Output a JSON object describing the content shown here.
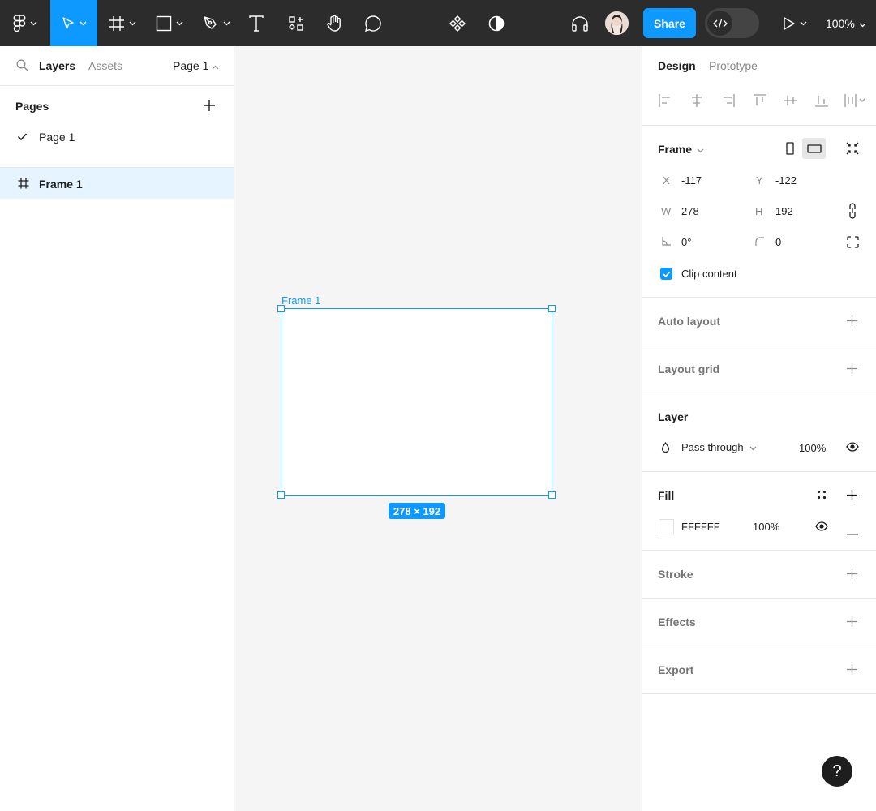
{
  "toolbar": {
    "share_label": "Share",
    "zoom_label": "100%",
    "tools": [
      "figma-menu",
      "move",
      "frame",
      "shape",
      "pen",
      "text",
      "resources",
      "hand",
      "comment"
    ],
    "active_tool": "move",
    "accent": "#0d99ff",
    "bg": "#2c2c2c"
  },
  "left_panel": {
    "tab_layers": "Layers",
    "tab_assets": "Assets",
    "page_selector": "Page 1",
    "pages_header": "Pages",
    "pages": [
      {
        "name": "Page 1",
        "current": true
      }
    ],
    "layers": [
      {
        "name": "Frame 1",
        "type": "frame",
        "selected": true
      }
    ]
  },
  "canvas": {
    "frame_label": "Frame 1",
    "dimensions": "278 × 192"
  },
  "right_panel": {
    "tab_design": "Design",
    "tab_prototype": "Prototype",
    "frame": {
      "title": "Frame",
      "x_label": "X",
      "x": "-117",
      "y_label": "Y",
      "y": "-122",
      "w_label": "W",
      "w": "278",
      "h_label": "H",
      "h": "192",
      "rotation": "0°",
      "radius": "0",
      "clip_content_label": "Clip content",
      "clip_content": true
    },
    "auto_layout": "Auto layout",
    "layout_grid": "Layout grid",
    "layer": {
      "title": "Layer",
      "blend_mode": "Pass through",
      "opacity": "100%"
    },
    "fill": {
      "title": "Fill",
      "hex": "FFFFFF",
      "opacity": "100%",
      "color": "#ffffff"
    },
    "stroke": "Stroke",
    "effects": "Effects",
    "export": "Export"
  },
  "help_label": "?"
}
